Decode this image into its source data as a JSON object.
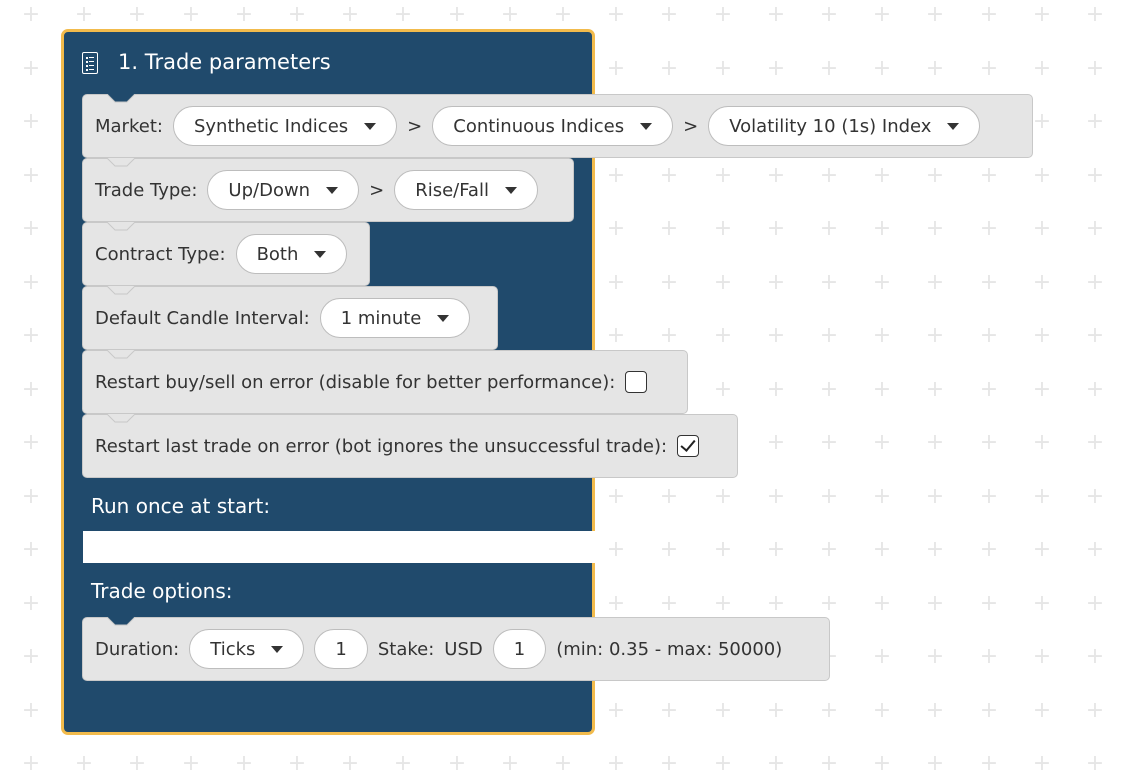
{
  "block": {
    "title": "1. Trade parameters",
    "icon": "document-list-icon",
    "colors": {
      "block_bg": "#204a6c",
      "block_border": "#f2bb4c",
      "statement_bg": "#e5e5e5",
      "pill_bg": "#ffffff",
      "text": "#333333"
    }
  },
  "market": {
    "label": "Market:",
    "separator": ">",
    "market_value": "Synthetic Indices",
    "submarket_value": "Continuous Indices",
    "symbol_value": "Volatility 10 (1s) Index"
  },
  "trade_type": {
    "label": "Trade Type:",
    "separator": ">",
    "category_value": "Up/Down",
    "type_value": "Rise/Fall"
  },
  "contract_type": {
    "label": "Contract Type:",
    "value": "Both"
  },
  "candle_interval": {
    "label": "Default Candle Interval:",
    "value": "1 minute"
  },
  "restart_buy_sell": {
    "label": "Restart buy/sell on error (disable for better performance):",
    "checked": false
  },
  "restart_last_trade": {
    "label": "Restart last trade on error (bot ignores the unsuccessful trade):",
    "checked": true
  },
  "run_once": {
    "label": "Run once at start:"
  },
  "trade_options": {
    "label": "Trade options:",
    "duration_label": "Duration:",
    "duration_unit": "Ticks",
    "duration_value": "1",
    "stake_label": "Stake:",
    "currency": "USD",
    "stake_value": "1",
    "limits": "(min: 0.35 - max: 50000)"
  }
}
